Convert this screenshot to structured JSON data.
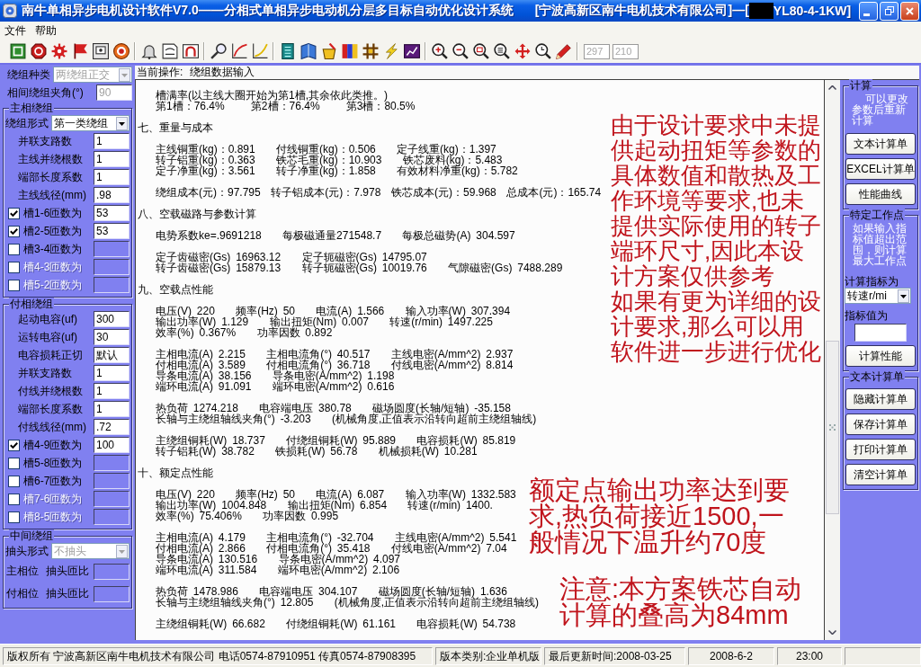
{
  "window": {
    "title": "南牛单相异步电机设计软件V7.0——分相式单相异步电动机分层多目标自动优化设计系统",
    "company": "[宁波高新区南牛电机技术有限公司]—[",
    "model": "YL80-4-1KW]"
  },
  "menu": [
    "文件",
    "帮助"
  ],
  "toolbar": {
    "fields": [
      {
        "value": "297",
        "disabled": true
      },
      {
        "value": "210",
        "disabled": true
      }
    ]
  },
  "winding_panel": {
    "sections": [
      {
        "rows": [
          {
            "kind": "combo",
            "label": "绕组种类",
            "value": "两绕组正交",
            "disabled": true
          },
          {
            "kind": "field",
            "label": "相间绕组夹角(°)",
            "value": "90",
            "disabled": true
          }
        ]
      },
      {
        "title": "主相绕组",
        "rows": [
          {
            "kind": "combo",
            "label": "绕组形式",
            "value": "第一类绕组",
            "disabled": false
          },
          {
            "kind": "field",
            "label": "并联支路数",
            "value": "1",
            "disabled": false
          },
          {
            "kind": "field",
            "label": "主线并绕根数",
            "value": "1",
            "disabled": false
          },
          {
            "kind": "field",
            "label": "端部长度系数",
            "value": "1",
            "disabled": false
          },
          {
            "kind": "field",
            "label": "主线线径(mm)",
            "value": ".98",
            "disabled": false
          },
          {
            "kind": "check",
            "label": "槽1-6匝数为",
            "checked": true,
            "disabled": false,
            "value": "53"
          },
          {
            "kind": "check",
            "label": "槽2-5匝数为",
            "checked": true,
            "disabled": false,
            "value": "53"
          },
          {
            "kind": "check",
            "label": "槽3-4匝数为",
            "checked": false,
            "disabled": false
          },
          {
            "kind": "check",
            "label": "槽4-3匝数为",
            "checked": false,
            "disabled": true
          },
          {
            "kind": "check",
            "label": "槽5-2匝数为",
            "checked": false,
            "disabled": true
          }
        ]
      },
      {
        "title": "付相绕组",
        "rows": [
          {
            "kind": "field",
            "label": "起动电容(uf)",
            "value": "300",
            "disabled": false
          },
          {
            "kind": "field",
            "label": "运转电容(uf)",
            "value": "30",
            "disabled": false
          },
          {
            "kind": "field",
            "label": "电容损耗正切",
            "value": "默认",
            "disabled": false
          },
          {
            "kind": "field",
            "label": "并联支路数",
            "value": "1",
            "disabled": false
          },
          {
            "kind": "field",
            "label": "付线并绕根数",
            "value": "1",
            "disabled": false
          },
          {
            "kind": "field",
            "label": "端部长度系数",
            "value": "1",
            "disabled": false
          },
          {
            "kind": "field",
            "label": "付线线径(mm)",
            "value": ".72",
            "disabled": false
          },
          {
            "kind": "check",
            "label": "槽4-9匝数为",
            "checked": true,
            "disabled": false,
            "value": "100"
          },
          {
            "kind": "check",
            "label": "槽5-8匝数为",
            "checked": false,
            "disabled": false
          },
          {
            "kind": "check",
            "label": "槽6-7匝数为",
            "checked": false,
            "disabled": false
          },
          {
            "kind": "check",
            "label": "槽7-6匝数为",
            "checked": false,
            "disabled": true
          },
          {
            "kind": "check",
            "label": "槽8-5匝数为",
            "checked": false,
            "disabled": true
          }
        ]
      },
      {
        "title": "中间绕组",
        "rows": [
          {
            "kind": "combo",
            "label": "抽头形式",
            "value": "不抽头",
            "disabled": true
          },
          {
            "kind": "pair",
            "labels": [
              "主相位",
              "抽头匝比"
            ]
          },
          {
            "kind": "pair",
            "labels": [
              "付相位",
              "抽头匝比"
            ]
          }
        ]
      }
    ]
  },
  "report": {
    "operation_label": "当前操作:",
    "operation": "绕组数据输入",
    "items": [
      {
        "kind": "group",
        "rows": [
          "槽满率(以主线大圈开始为第1槽,其余依此类推。)",
          "第1槽：76.4%     第2槽：76.4%     第3槽：80.5%"
        ]
      },
      {
        "kind": "heading",
        "text": "七、重量与成本"
      },
      {
        "kind": "group",
        "rows": [
          "主线铜重(kg)：0.891    付线铜重(kg)：0.506    定子线重(kg)：1.397",
          "转子铝重(kg)：0.363    铁芯毛重(kg)：10.903    铁芯废料(kg)：5.483",
          "定子净重(kg)：3.561    转子净重(kg)：1.858    有效材料净重(kg)：5.782"
        ]
      },
      {
        "kind": "group",
        "rows": [
          "绕组成本(元)：97.795  转子铝成本(元)：7.978  铁芯成本(元)：59.968  总成本(元)：165.74"
        ]
      },
      {
        "kind": "heading",
        "text": "八、空载磁路与参数计算"
      },
      {
        "kind": "group",
        "rows": [
          "电势系数ke=.9691218    每极磁通量271548.7    每极总磁势(A) 304.597"
        ]
      },
      {
        "kind": "group",
        "rows": [
          "定子齿磁密(Gs) 16963.12    定子轭磁密(Gs) 14795.07",
          "转子齿磁密(Gs) 15879.13    转子轭磁密(Gs) 10019.76    气隙磁密(Gs) 7488.289"
        ]
      },
      {
        "kind": "heading",
        "text": "九、空载点性能"
      },
      {
        "kind": "group",
        "rows": [
          "电压(V) 220    频率(Hz) 50    电流(A) 1.566    输入功率(W) 307.394",
          "输出功率(W) 1.129    输出扭矩(Nm) 0.007    转速(r/min) 1497.225",
          "效率(%) 0.367%    功率因数 0.892"
        ]
      },
      {
        "kind": "group",
        "rows": [
          "主相电流(A) 2.215    主相电流角(°) 40.517    主线电密(A/mm^2) 2.937",
          "付相电流(A) 3.589    付相电流角(°) 36.718    付线电密(A/mm^2) 8.814",
          "导条电流(A) 38.156    导条电密(A/mm^2) 1.198",
          "端环电流(A) 91.091    端环电密(A/mm^2) 0.616"
        ]
      },
      {
        "kind": "group",
        "rows": [
          "热负荷 1274.218    电容端电压 380.78    磁场圆度(长轴/短轴) -35.158",
          "长轴与主绕组轴线夹角(°) -3.203    (机械角度,正值表示沿转向超前主绕组轴线)"
        ]
      },
      {
        "kind": "group",
        "rows": [
          "主绕组铜耗(W) 18.737    付绕组铜耗(W) 95.889    电容损耗(W) 85.819",
          "转子铝耗(W) 38.782    铁损耗(W) 56.78    机械损耗(W) 10.281"
        ]
      },
      {
        "kind": "heading",
        "text": "十、额定点性能"
      },
      {
        "kind": "group",
        "rows": [
          "电压(V) 220    频率(Hz) 50    电流(A) 6.087    输入功率(W) 1332.583",
          "输出功率(W) 1004.848    输出扭矩(Nm) 6.854    转速(r/min) 1400.",
          "效率(%) 75.406%    功率因数 0.995"
        ]
      },
      {
        "kind": "group",
        "rows": [
          "主相电流(A) 4.179    主相电流角(°) -32.704    主线电密(A/mm^2) 5.541",
          "付相电流(A) 2.866    付相电流角(°) 35.418    付线电密(A/mm^2) 7.04",
          "导条电流(A) 130.516    导条电密(A/mm^2) 4.097",
          "端环电流(A) 311.584    端环电密(A/mm^2) 2.106"
        ]
      },
      {
        "kind": "group",
        "rows": [
          "热负荷 1478.986    电容端电压 304.107    磁场圆度(长轴/短轴) 1.636",
          "长轴与主绕组轴线夹角(°) 12.805    (机械角度,正值表示沿转向超前主绕组轴线)"
        ]
      },
      {
        "kind": "group",
        "rows": [
          "主绕组铜耗(W) 66.682    付绕组铜耗(W) 61.161    电容损耗(W) 54.738"
        ]
      }
    ],
    "annotations": [
      {
        "paragraphs": [
          [
            "由于设计要求中未提",
            "供起动扭矩等参数的",
            "具体数值和散热及工",
            "作环境等要求,也未",
            "提供实际使用的转子",
            "端环尺寸,因此本设",
            "计方案仅供参考"
          ],
          [
            "如果有更为详细的设",
            "计要求,那么可以用",
            "软件进一步进行优化"
          ]
        ]
      },
      {
        "paragraphs": [
          [
            "额定点输出功率达到要",
            "求,热负荷接近1500,一",
            "般情况下温升约70度"
          ]
        ]
      },
      {
        "paragraphs": [
          [
            "注意:本方案铁芯自动",
            "计算的叠高为84mm"
          ]
        ]
      }
    ]
  },
  "calc_panel": {
    "groups": [
      {
        "title": "计算",
        "note": "可以更改参数后重新计算",
        "items": [
          {
            "kind": "button",
            "label": "文本计算单"
          },
          {
            "kind": "button",
            "label": "EXCEL计算单"
          },
          {
            "kind": "button",
            "label": "性能曲线"
          }
        ]
      },
      {
        "title": "特定工作点",
        "note": "如果输入指标值超出范围，则计算最大工作点",
        "items": [
          {
            "kind": "label",
            "text": "计算指标为"
          },
          {
            "kind": "combo",
            "value": "转速r/mi"
          },
          {
            "kind": "label",
            "text": "指标值为"
          },
          {
            "kind": "input"
          },
          {
            "kind": "button",
            "label": "计算性能"
          }
        ]
      },
      {
        "title": "文本计算单",
        "items": [
          {
            "kind": "button",
            "label": "隐藏计算单"
          },
          {
            "kind": "button",
            "label": "保存计算单"
          },
          {
            "kind": "button",
            "label": "打印计算单"
          },
          {
            "kind": "button",
            "label": "清空计算单"
          }
        ]
      }
    ]
  },
  "status_bar": [
    "版权所有 宁波高新区南牛电机技术有限公司 电话0574-87910951 传真0574-87908395",
    "版本类别:企业单机版",
    "最后更新时间:2008-03-25",
    "2008-6-2",
    "23:00"
  ]
}
